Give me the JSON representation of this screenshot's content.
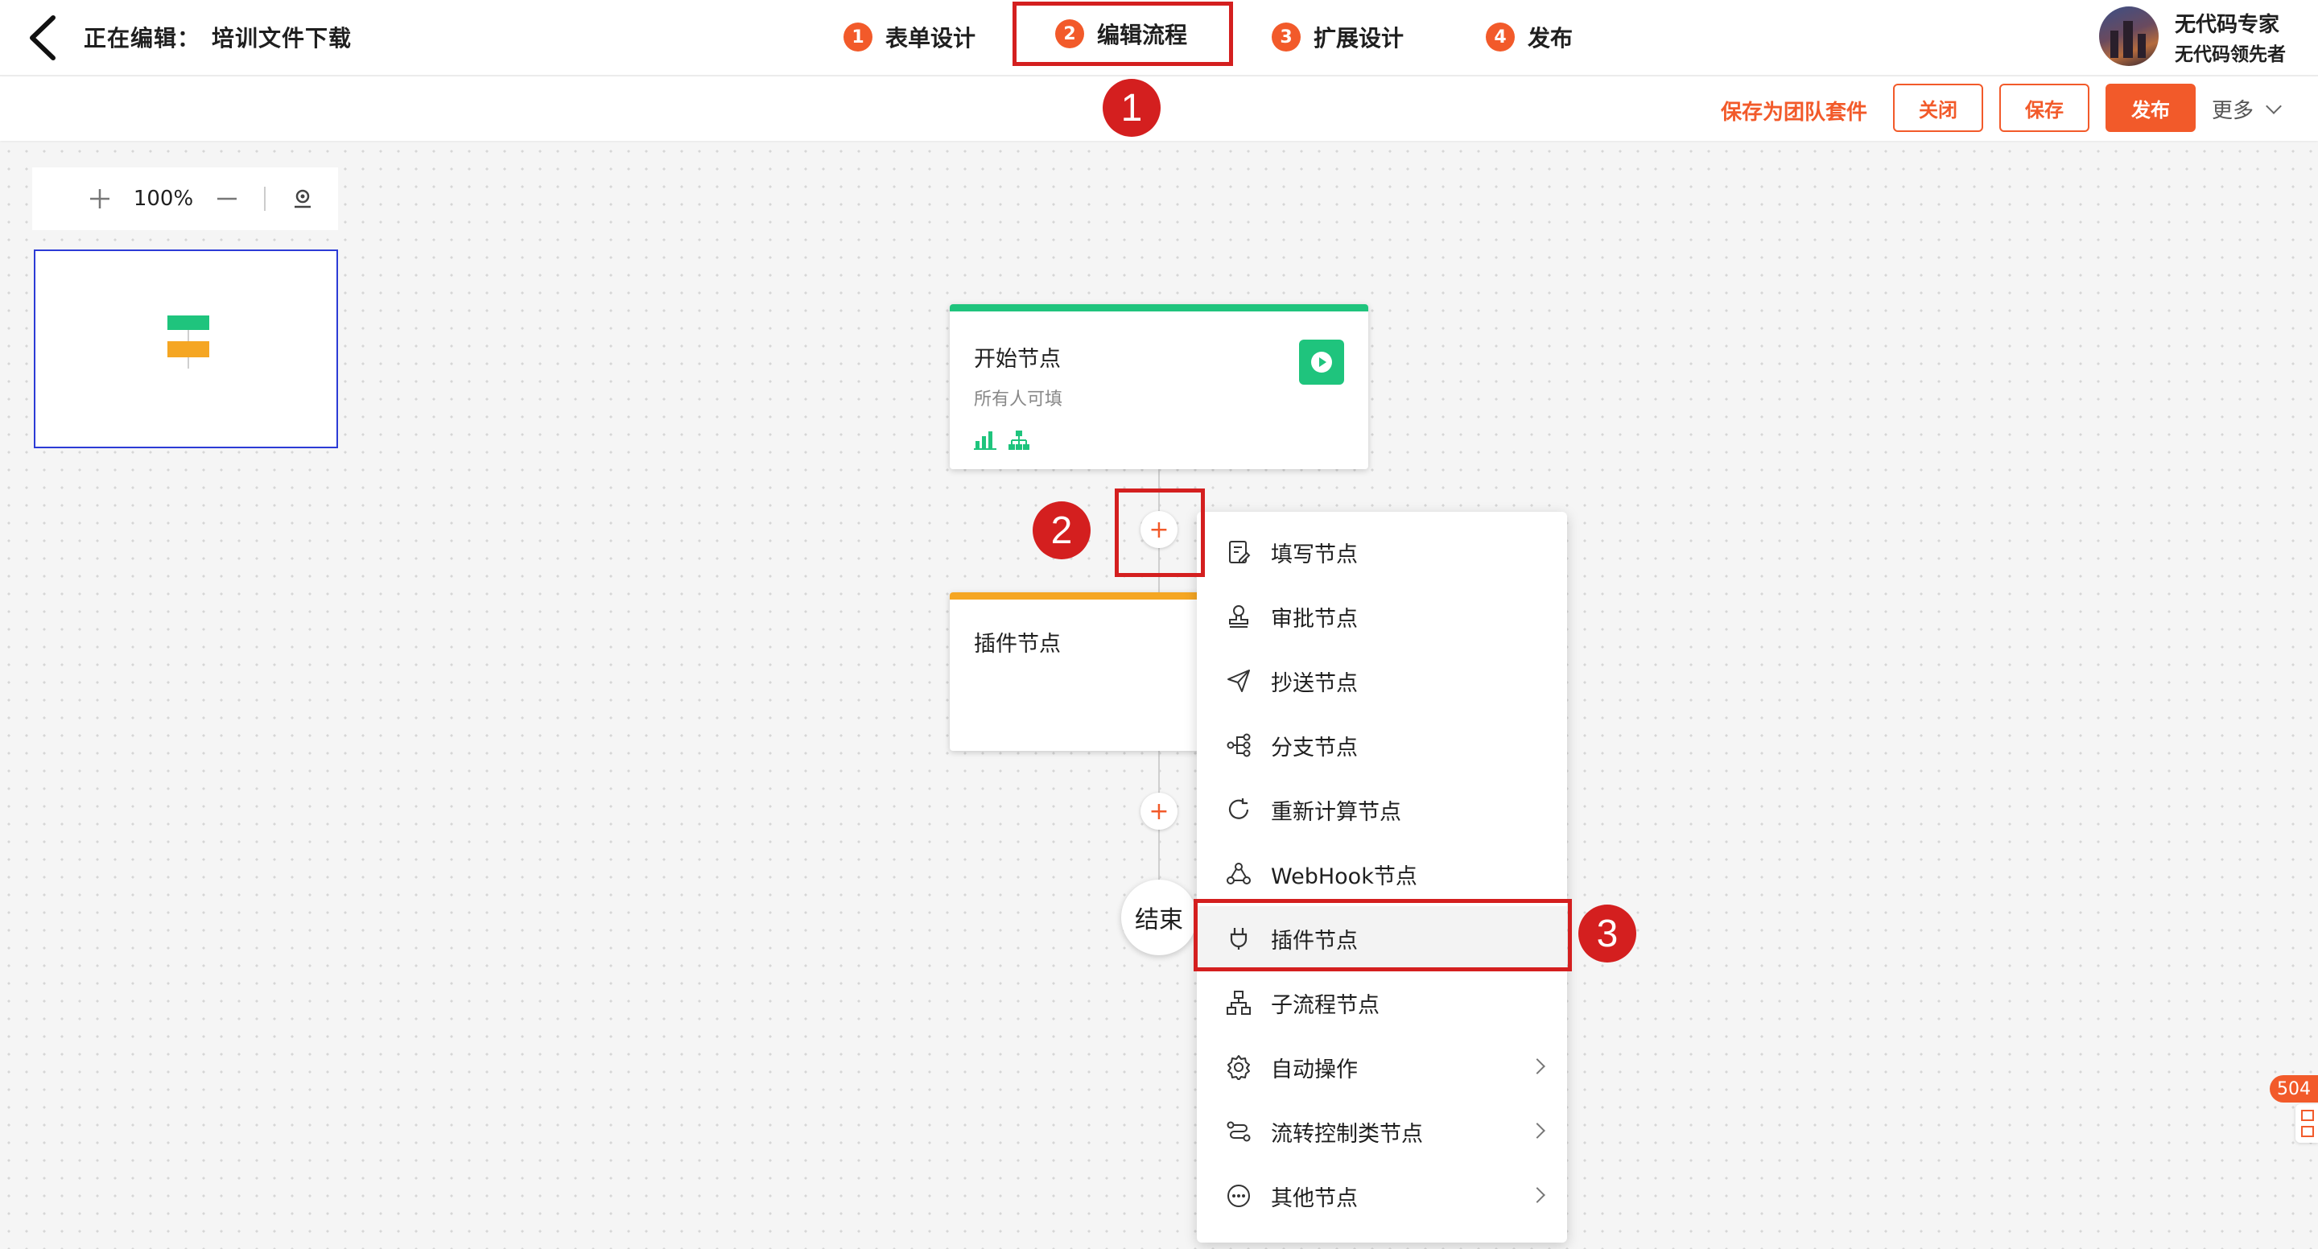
{
  "header": {
    "editing_label": "正在编辑：",
    "file_name": "培训文件下载",
    "steps": [
      {
        "num": "1",
        "label": "表单设计"
      },
      {
        "num": "2",
        "label": "编辑流程"
      },
      {
        "num": "3",
        "label": "扩展设计"
      },
      {
        "num": "4",
        "label": "发布"
      }
    ],
    "user": {
      "name": "无代码专家",
      "title": "无代码领先者"
    }
  },
  "toolbar": {
    "save_team": "保存为团队套件",
    "close": "关闭",
    "save": "保存",
    "publish": "发布",
    "more": "更多"
  },
  "zoom": {
    "level": "100%"
  },
  "flow": {
    "start_node": {
      "title": "开始节点",
      "subtitle": "所有人可填"
    },
    "plugin_node": {
      "title": "插件节点"
    },
    "end_node": {
      "label": "结束"
    }
  },
  "menu": {
    "items": [
      {
        "label": "填写节点",
        "icon": "form-fill-icon"
      },
      {
        "label": "审批节点",
        "icon": "stamp-icon"
      },
      {
        "label": "抄送节点",
        "icon": "send-icon"
      },
      {
        "label": "分支节点",
        "icon": "branch-icon"
      },
      {
        "label": "重新计算节点",
        "icon": "refresh-icon"
      },
      {
        "label": "WebHook节点",
        "icon": "webhook-icon"
      },
      {
        "label": "插件节点",
        "icon": "plug-icon"
      },
      {
        "label": "子流程节点",
        "icon": "subflow-icon"
      },
      {
        "label": "自动操作",
        "icon": "gear-icon"
      },
      {
        "label": "流转控制类节点",
        "icon": "flow-control-icon"
      },
      {
        "label": "其他节点",
        "icon": "more-dots-icon"
      }
    ]
  },
  "annotations": {
    "badge1": "1",
    "badge2": "2",
    "badge3": "3"
  },
  "side_counter": "504",
  "colors": {
    "accent": "#f25a2a",
    "start_bar": "#1fc47d",
    "plugin_bar": "#f5a623",
    "annotation": "#d41f1f"
  }
}
